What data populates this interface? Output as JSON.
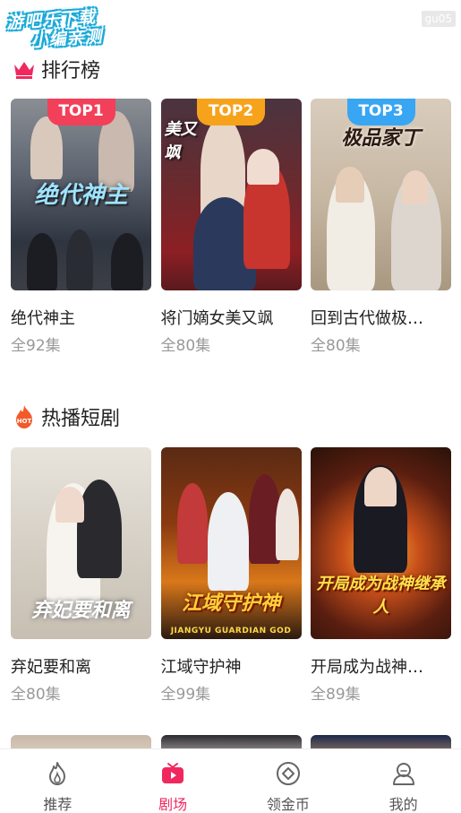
{
  "watermark": {
    "line1": "游吧乐下载",
    "line2": "小编亲测"
  },
  "corner_tag": "gu05",
  "rank_section": {
    "title": "排行榜",
    "items": [
      {
        "badge": "TOP1",
        "badge_color": "#f2405a",
        "name": "绝代神主",
        "count": "全92集",
        "cover_text": "绝代神主"
      },
      {
        "badge": "TOP2",
        "badge_color": "#f7a21b",
        "name": "将门嫡女美又飒",
        "count": "全80集",
        "cover_text": "美又飒"
      },
      {
        "badge": "TOP3",
        "badge_color": "#38a6f2",
        "name": "回到古代做极…",
        "count": "全80集",
        "cover_text": "极品家丁"
      }
    ]
  },
  "hot_section": {
    "title": "热播短剧",
    "icon_text": "HOT",
    "items": [
      {
        "name": "弃妃要和离",
        "count": "全80集",
        "cover_text": "弃妃要和离",
        "cover_sub": ""
      },
      {
        "name": "江域守护神",
        "count": "全99集",
        "cover_text": "江域守护神",
        "cover_sub": "JIANGYU GUARDIAN GOD"
      },
      {
        "name": "开局成为战神…",
        "count": "全89集",
        "cover_text": "开局成为战神继承人",
        "cover_sub": ""
      }
    ]
  },
  "tabbar": {
    "tabs": [
      {
        "label": "推荐",
        "icon": "flame-icon",
        "active": false
      },
      {
        "label": "剧场",
        "icon": "play-tv-icon",
        "active": true
      },
      {
        "label": "领金币",
        "icon": "coin-diamond-icon",
        "active": false
      },
      {
        "label": "我的",
        "icon": "user-icon",
        "active": false
      }
    ]
  },
  "colors": {
    "accent": "#f0285f",
    "text_primary": "#222222",
    "text_secondary": "#999999"
  }
}
